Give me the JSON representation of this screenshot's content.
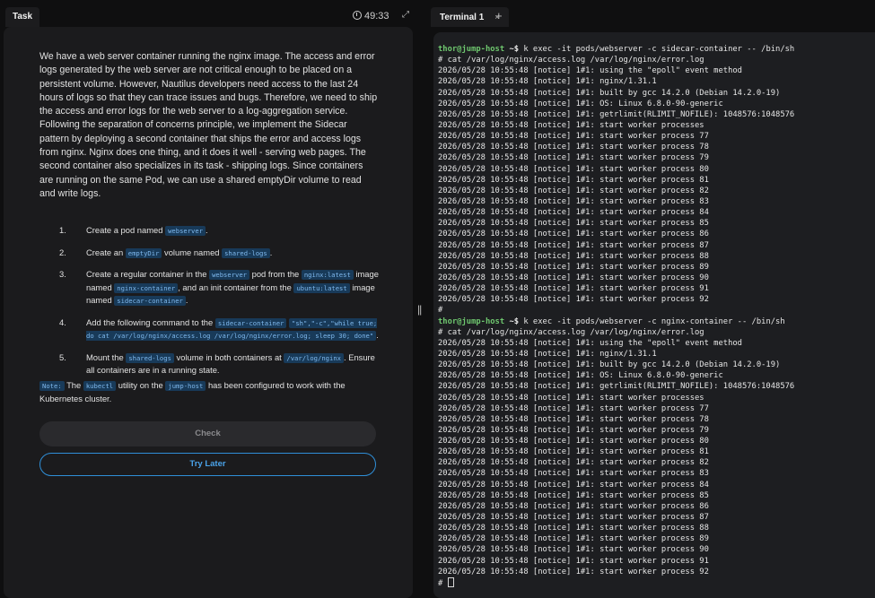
{
  "task_tab": {
    "label": "Task"
  },
  "timer": "49:33",
  "terminal_tab": {
    "label": "Terminal 1",
    "close": "×",
    "add": "+"
  },
  "description": "We have a web server container running the nginx image. The access and error logs generated by the web server are not critical enough to be placed on a persistent volume. However, Nautilus developers need access to the last 24 hours of logs so that they can trace issues and bugs. Therefore, we need to ship the access and error logs for the web server to a log-aggregation service. Following the separation of concerns principle, we implement the Sidecar pattern by deploying a second container that ships the error and access logs from nginx. Nginx does one thing, and it does it well - serving web pages. The second container also specializes in its task - shipping logs. Since containers are running on the same Pod, we can use a shared emptyDir volume to read and write logs.",
  "steps": [
    {
      "num": "1.",
      "parts": [
        {
          "t": "Create a pod named "
        },
        {
          "c": "webserver"
        },
        {
          "t": "."
        }
      ]
    },
    {
      "num": "2.",
      "parts": [
        {
          "t": "Create an "
        },
        {
          "c": "emptyDir"
        },
        {
          "t": " volume named "
        },
        {
          "c": "shared-logs"
        },
        {
          "t": "."
        }
      ]
    },
    {
      "num": "3.",
      "parts": [
        {
          "t": "Create a regular container in the "
        },
        {
          "c": "webserver"
        },
        {
          "t": " pod from the "
        },
        {
          "c": "nginx:latest"
        },
        {
          "t": " image named "
        },
        {
          "c": "nginx-container"
        },
        {
          "t": ", and an init container from the "
        },
        {
          "c": "ubuntu:latest"
        },
        {
          "t": " image named "
        },
        {
          "c": "sidecar-container"
        },
        {
          "t": "."
        }
      ]
    },
    {
      "num": "4.",
      "parts": [
        {
          "t": "Add the following command to the "
        },
        {
          "c": "sidecar-container"
        },
        {
          "t": " "
        },
        {
          "c": "\"sh\",\"-c\",\"while true; do cat /var/log/nginx/access.log /var/log/nginx/error.log; sleep 30; done\""
        },
        {
          "t": "."
        }
      ]
    },
    {
      "num": "5.",
      "parts": [
        {
          "t": "Mount the "
        },
        {
          "c": "shared-logs"
        },
        {
          "t": " volume in both containers at "
        },
        {
          "c": "/var/log/nginx"
        },
        {
          "t": ". Ensure all containers are in a running state."
        }
      ]
    }
  ],
  "note": {
    "label": "Note:",
    "parts": [
      {
        "t": " The "
      },
      {
        "c": "kubectl"
      },
      {
        "t": " utility on the "
      },
      {
        "c": "jump-host"
      },
      {
        "t": " has been configured to work with the Kubernetes cluster."
      }
    ]
  },
  "buttons": {
    "check": "Check",
    "later": "Try Later"
  },
  "terminal": {
    "prompt_user": "thor@jump-host",
    "prompt_dir": " ~$",
    "lines": [
      {
        "prompt": true,
        "cmd": " k exec -it pods/webserver -c sidecar-container -- /bin/sh"
      },
      {
        "text": "# cat /var/log/nginx/access.log /var/log/nginx/error.log"
      },
      {
        "text": "2026/05/28 10:55:48 [notice] 1#1: using the \"epoll\" event method"
      },
      {
        "text": "2026/05/28 10:55:48 [notice] 1#1: nginx/1.31.1"
      },
      {
        "text": "2026/05/28 10:55:48 [notice] 1#1: built by gcc 14.2.0 (Debian 14.2.0-19)"
      },
      {
        "text": "2026/05/28 10:55:48 [notice] 1#1: OS: Linux 6.8.0-90-generic"
      },
      {
        "text": "2026/05/28 10:55:48 [notice] 1#1: getrlimit(RLIMIT_NOFILE): 1048576:1048576"
      },
      {
        "text": "2026/05/28 10:55:48 [notice] 1#1: start worker processes"
      },
      {
        "text": "2026/05/28 10:55:48 [notice] 1#1: start worker process 77"
      },
      {
        "text": "2026/05/28 10:55:48 [notice] 1#1: start worker process 78"
      },
      {
        "text": "2026/05/28 10:55:48 [notice] 1#1: start worker process 79"
      },
      {
        "text": "2026/05/28 10:55:48 [notice] 1#1: start worker process 80"
      },
      {
        "text": "2026/05/28 10:55:48 [notice] 1#1: start worker process 81"
      },
      {
        "text": "2026/05/28 10:55:48 [notice] 1#1: start worker process 82"
      },
      {
        "text": "2026/05/28 10:55:48 [notice] 1#1: start worker process 83"
      },
      {
        "text": "2026/05/28 10:55:48 [notice] 1#1: start worker process 84"
      },
      {
        "text": "2026/05/28 10:55:48 [notice] 1#1: start worker process 85"
      },
      {
        "text": "2026/05/28 10:55:48 [notice] 1#1: start worker process 86"
      },
      {
        "text": "2026/05/28 10:55:48 [notice] 1#1: start worker process 87"
      },
      {
        "text": "2026/05/28 10:55:48 [notice] 1#1: start worker process 88"
      },
      {
        "text": "2026/05/28 10:55:48 [notice] 1#1: start worker process 89"
      },
      {
        "text": "2026/05/28 10:55:48 [notice] 1#1: start worker process 90"
      },
      {
        "text": "2026/05/28 10:55:48 [notice] 1#1: start worker process 91"
      },
      {
        "text": "2026/05/28 10:55:48 [notice] 1#1: start worker process 92"
      },
      {
        "text": "#"
      },
      {
        "prompt": true,
        "cmd": " k exec -it pods/webserver -c nginx-container -- /bin/sh"
      },
      {
        "text": "# cat /var/log/nginx/access.log /var/log/nginx/error.log"
      },
      {
        "text": "2026/05/28 10:55:48 [notice] 1#1: using the \"epoll\" event method"
      },
      {
        "text": "2026/05/28 10:55:48 [notice] 1#1: nginx/1.31.1"
      },
      {
        "text": "2026/05/28 10:55:48 [notice] 1#1: built by gcc 14.2.0 (Debian 14.2.0-19)"
      },
      {
        "text": "2026/05/28 10:55:48 [notice] 1#1: OS: Linux 6.8.0-90-generic"
      },
      {
        "text": "2026/05/28 10:55:48 [notice] 1#1: getrlimit(RLIMIT_NOFILE): 1048576:1048576"
      },
      {
        "text": "2026/05/28 10:55:48 [notice] 1#1: start worker processes"
      },
      {
        "text": "2026/05/28 10:55:48 [notice] 1#1: start worker process 77"
      },
      {
        "text": "2026/05/28 10:55:48 [notice] 1#1: start worker process 78"
      },
      {
        "text": "2026/05/28 10:55:48 [notice] 1#1: start worker process 79"
      },
      {
        "text": "2026/05/28 10:55:48 [notice] 1#1: start worker process 80"
      },
      {
        "text": "2026/05/28 10:55:48 [notice] 1#1: start worker process 81"
      },
      {
        "text": "2026/05/28 10:55:48 [notice] 1#1: start worker process 82"
      },
      {
        "text": "2026/05/28 10:55:48 [notice] 1#1: start worker process 83"
      },
      {
        "text": "2026/05/28 10:55:48 [notice] 1#1: start worker process 84"
      },
      {
        "text": "2026/05/28 10:55:48 [notice] 1#1: start worker process 85"
      },
      {
        "text": "2026/05/28 10:55:48 [notice] 1#1: start worker process 86"
      },
      {
        "text": "2026/05/28 10:55:48 [notice] 1#1: start worker process 87"
      },
      {
        "text": "2026/05/28 10:55:48 [notice] 1#1: start worker process 88"
      },
      {
        "text": "2026/05/28 10:55:48 [notice] 1#1: start worker process 89"
      },
      {
        "text": "2026/05/28 10:55:48 [notice] 1#1: start worker process 90"
      },
      {
        "text": "2026/05/28 10:55:48 [notice] 1#1: start worker process 91"
      },
      {
        "text": "2026/05/28 10:55:48 [notice] 1#1: start worker process 92"
      },
      {
        "text": "# ",
        "cursor": true
      }
    ]
  }
}
